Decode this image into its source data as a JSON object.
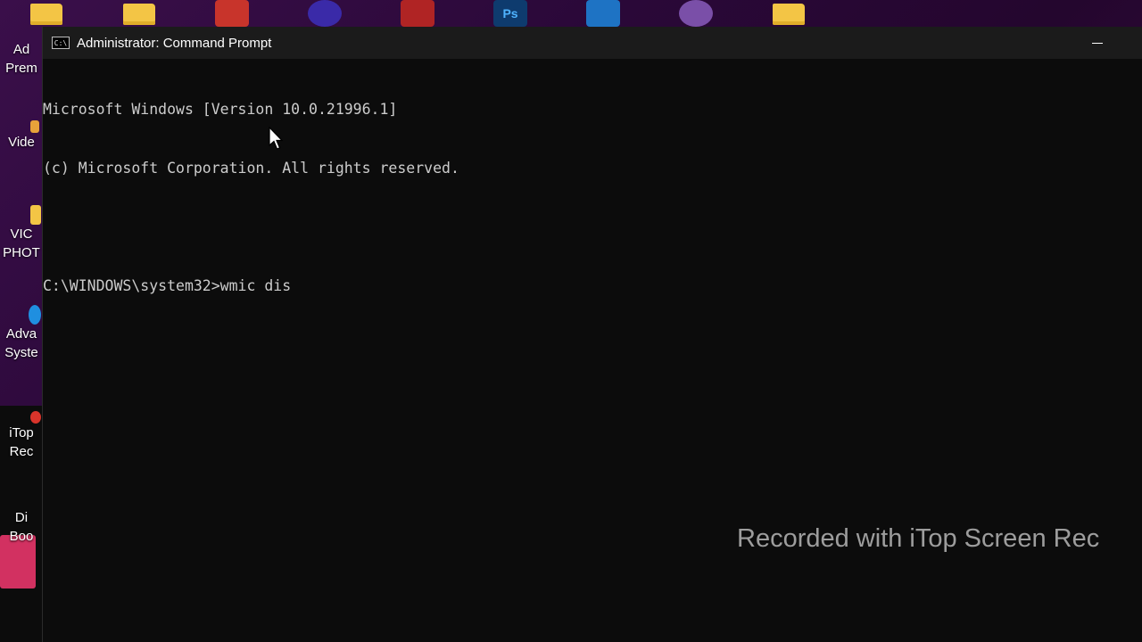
{
  "desktop": {
    "top_icons": [
      {
        "name": "folder-icon",
        "kind": "folder"
      },
      {
        "name": "folder-icon",
        "kind": "folder"
      },
      {
        "name": "toolbox-app-icon",
        "kind": "app",
        "color": "#c8342b"
      },
      {
        "name": "browser-app-icon",
        "kind": "app",
        "color": "#3a2aa8"
      },
      {
        "name": "media-app-icon",
        "kind": "app",
        "color": "#b02424"
      },
      {
        "name": "photoshop-icon",
        "kind": "app",
        "color": "#0e3b6e",
        "label": "Ps"
      },
      {
        "name": "vscode-icon",
        "kind": "app",
        "color": "#1e73c4"
      },
      {
        "name": "tor-browser-icon",
        "kind": "app",
        "color": "#7a4fa8"
      },
      {
        "name": "folder-icon",
        "kind": "folder"
      }
    ],
    "left_icons": [
      {
        "label": "Ad\nPrem"
      },
      {
        "label": "Vide"
      },
      {
        "label": "VIC\nPHOT"
      },
      {
        "label": "Adva\nSyste"
      },
      {
        "label": "iTop\nRec"
      },
      {
        "label": "Di\nBoo"
      }
    ]
  },
  "window": {
    "title": "Administrator: Command Prompt",
    "title_icon_glyph": "C:\\",
    "console_lines": [
      "Microsoft Windows [Version 10.0.21996.1]",
      "(c) Microsoft Corporation. All rights reserved.",
      "",
      "C:\\WINDOWS\\system32>wmic dis"
    ]
  },
  "watermark": "Recorded with iTop Screen Rec",
  "colors": {
    "console_bg": "#0c0c0c",
    "console_text": "#cccccc",
    "titlebar_bg": "#1b1b1b"
  }
}
